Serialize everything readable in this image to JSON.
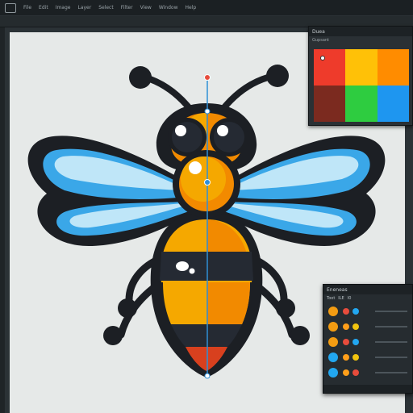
{
  "app": {
    "menu": [
      "File",
      "Edit",
      "Image",
      "Layer",
      "Select",
      "Filter",
      "View",
      "Window",
      "Help"
    ]
  },
  "swatches": {
    "title": "Duea",
    "subtitle": "Gupsant",
    "colors": [
      "#ee3b2b",
      "#ffc107",
      "#ff8c00",
      "#7b2a1f",
      "#2ecc40",
      "#1e96f0"
    ]
  },
  "layers": {
    "title": "Eneneas",
    "tabs": [
      "Toot",
      "ILE",
      "I0"
    ],
    "rows": [
      {
        "a": "#f39c12",
        "b": "#e74c3c",
        "c": "#22a7f0"
      },
      {
        "a": "#f39c12",
        "b": "#ff9f1a",
        "c": "#f1c40f"
      },
      {
        "a": "#f39c12",
        "b": "#e74c3c",
        "c": "#22a7f0"
      },
      {
        "a": "#22a7f0",
        "b": "#ff9f1a",
        "c": "#f1c40f"
      },
      {
        "a": "#22a7f0",
        "b": "#ff9f1a",
        "c": "#e74c3c"
      }
    ]
  },
  "artwork": {
    "subject": "bee-illustration",
    "colors": {
      "outline": "#1c1f24",
      "body_yellow": "#f5a800",
      "body_orange": "#f28a00",
      "body_black": "#252a33",
      "tip_red": "#d8401e",
      "wing_light": "#bfe6f8",
      "wing_blue": "#3aa7e8",
      "eye_white": "#ffffff",
      "guide_blue": "#2e8fd6"
    }
  }
}
